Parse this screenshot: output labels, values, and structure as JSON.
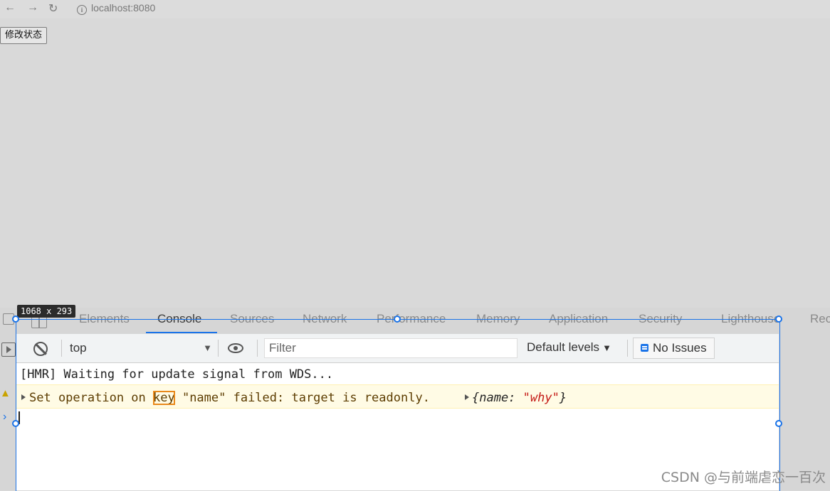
{
  "browser": {
    "back_icon": "arrow-left-icon",
    "forward_icon": "arrow-right-icon",
    "reload_icon": "reload-icon",
    "url": "localhost:8080"
  },
  "page": {
    "button_label": "修改状态"
  },
  "devtools": {
    "dimensions_badge": "1068 x 293",
    "tabs": [
      "Elements",
      "Console",
      "Sources",
      "Network",
      "Performance",
      "Memory",
      "Application",
      "Security",
      "Lighthouse",
      "Rec"
    ],
    "active_tab": "Console",
    "toolbar": {
      "context": "top",
      "filter_placeholder": "Filter",
      "levels_label": "Default levels",
      "issues_label": "No Issues"
    },
    "console": {
      "log_message": "[HMR] Waiting for update signal from WDS...",
      "warning_prefix": "Set operation on ",
      "warning_highlight": "key",
      "warning_suffix": " \"name\" failed: target is readonly.",
      "object_preview_open": "{name: ",
      "object_preview_value": "\"why\"",
      "object_preview_close": "}"
    },
    "colors": {
      "accent": "#1a73e8",
      "warning_bg": "#fffbe5",
      "highlight_outline": "#e8881a"
    }
  },
  "watermark": "CSDN @与前端虐恋一百次"
}
